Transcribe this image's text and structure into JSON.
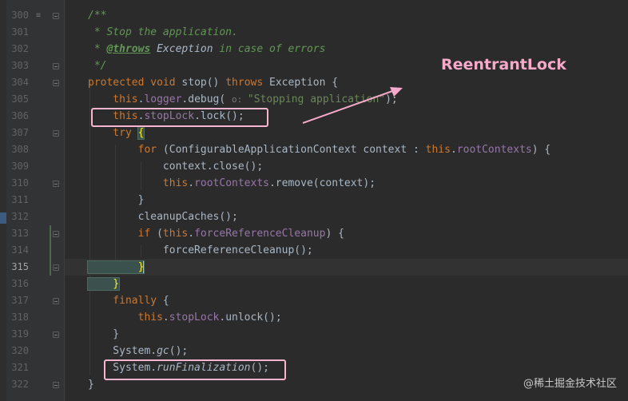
{
  "editor": {
    "lines": [
      {
        "n": "300",
        "tokens": [
          {
            "t": "/**",
            "c": "cm"
          }
        ]
      },
      {
        "n": "301",
        "tokens": [
          {
            "t": " * Stop the application.",
            "c": "cm"
          }
        ]
      },
      {
        "n": "302",
        "tokens": [
          {
            "t": " * ",
            "c": "cm"
          },
          {
            "t": "@throws",
            "c": "cm-tag"
          },
          {
            "t": " ",
            "c": "cm"
          },
          {
            "t": "Exception",
            "c": "cm-plain"
          },
          {
            "t": " in case of errors",
            "c": "cm"
          }
        ]
      },
      {
        "n": "303",
        "tokens": [
          {
            "t": " */",
            "c": "cm"
          }
        ]
      },
      {
        "n": "304",
        "tokens": [
          {
            "t": "protected ",
            "c": "kw"
          },
          {
            "t": "void ",
            "c": "kw"
          },
          {
            "t": "stop() ",
            "c": ""
          },
          {
            "t": "throws ",
            "c": "kw"
          },
          {
            "t": "Exception {",
            "c": ""
          }
        ]
      },
      {
        "n": "305",
        "tokens": [
          {
            "t": "    this",
            "c": "kw"
          },
          {
            "t": ".",
            "c": ""
          },
          {
            "t": "logger",
            "c": "fld"
          },
          {
            "t": ".debug( ",
            "c": ""
          },
          {
            "t": "o: ",
            "c": "hint"
          },
          {
            "t": "\"Stopping application\"",
            "c": "str"
          },
          {
            "t": ");",
            "c": ""
          }
        ]
      },
      {
        "n": "306",
        "tokens": [
          {
            "t": "    this",
            "c": "kw"
          },
          {
            "t": ".",
            "c": ""
          },
          {
            "t": "stopLock",
            "c": "fld"
          },
          {
            "t": ".lock();",
            "c": ""
          }
        ]
      },
      {
        "n": "307",
        "tokens": [
          {
            "t": "    try ",
            "c": "kw"
          },
          {
            "t": "{",
            "c": "brace-hl"
          }
        ]
      },
      {
        "n": "308",
        "tokens": [
          {
            "t": "        for ",
            "c": "kw"
          },
          {
            "t": "(ConfigurableApplicationContext context : ",
            "c": ""
          },
          {
            "t": "this",
            "c": "kw"
          },
          {
            "t": ".",
            "c": ""
          },
          {
            "t": "rootContexts",
            "c": "fld"
          },
          {
            "t": ") {",
            "c": ""
          }
        ]
      },
      {
        "n": "309",
        "tokens": [
          {
            "t": "            context.close();",
            "c": ""
          }
        ]
      },
      {
        "n": "310",
        "tokens": [
          {
            "t": "            this",
            "c": "kw"
          },
          {
            "t": ".",
            "c": ""
          },
          {
            "t": "rootContexts",
            "c": "fld"
          },
          {
            "t": ".remove(context);",
            "c": ""
          }
        ]
      },
      {
        "n": "311",
        "tokens": [
          {
            "t": "        }",
            "c": ""
          }
        ]
      },
      {
        "n": "312",
        "tokens": [
          {
            "t": "        cleanupCaches();",
            "c": ""
          }
        ]
      },
      {
        "n": "313",
        "tokens": [
          {
            "t": "        if ",
            "c": "kw"
          },
          {
            "t": "(",
            "c": ""
          },
          {
            "t": "this",
            "c": "kw"
          },
          {
            "t": ".",
            "c": ""
          },
          {
            "t": "forceReferenceCleanup",
            "c": "fld"
          },
          {
            "t": ") {",
            "c": ""
          }
        ]
      },
      {
        "n": "314",
        "tokens": [
          {
            "t": "            forceReferenceCleanup();",
            "c": ""
          }
        ]
      },
      {
        "n": "315",
        "tokens": [
          {
            "t": "        }",
            "c": "brace-hl"
          }
        ]
      },
      {
        "n": "316",
        "tokens": [
          {
            "t": "    }",
            "c": "brace-hl"
          }
        ]
      },
      {
        "n": "317",
        "tokens": [
          {
            "t": "    finally ",
            "c": "kw"
          },
          {
            "t": "{",
            "c": ""
          }
        ]
      },
      {
        "n": "318",
        "tokens": [
          {
            "t": "        this",
            "c": "kw"
          },
          {
            "t": ".",
            "c": ""
          },
          {
            "t": "stopLock",
            "c": "fld"
          },
          {
            "t": ".unlock();",
            "c": ""
          }
        ]
      },
      {
        "n": "319",
        "tokens": [
          {
            "t": "    }",
            "c": ""
          }
        ]
      },
      {
        "n": "320",
        "tokens": [
          {
            "t": "    System.",
            "c": ""
          },
          {
            "t": "gc",
            "c": "itl"
          },
          {
            "t": "();",
            "c": ""
          }
        ]
      },
      {
        "n": "321",
        "tokens": [
          {
            "t": "    System.",
            "c": ""
          },
          {
            "t": "runFinalization",
            "c": "itl"
          },
          {
            "t": "();",
            "c": ""
          }
        ]
      },
      {
        "n": "322",
        "tokens": [
          {
            "t": "}",
            "c": ""
          }
        ]
      }
    ]
  },
  "annotation": {
    "label": "ReentrantLock",
    "color": "#f6a9c9"
  },
  "watermark": "@稀土掘金技术社区",
  "icons": {
    "line300": "doc-comment-icon",
    "folds": "fold-marker-icon"
  },
  "colors": {
    "background": "#2b2b2b",
    "gutter": "#313335",
    "keyword": "#cc7832",
    "field": "#9876aa",
    "string": "#6a8759",
    "comment": "#629755",
    "highlight_box": "#f9b4cf"
  }
}
